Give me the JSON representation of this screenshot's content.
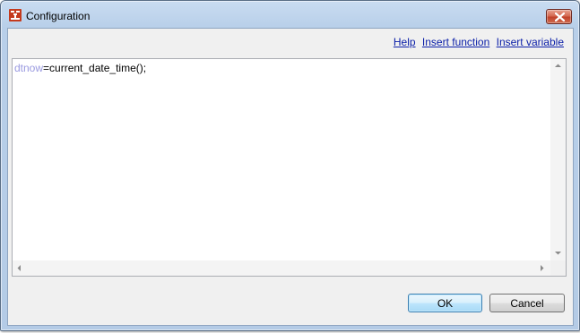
{
  "window": {
    "title": "Configuration",
    "app_icon": "flow-block-icon",
    "close_icon": "close-icon",
    "accent_color": "#c1432b"
  },
  "links": {
    "help": "Help",
    "insert_function": "Insert function",
    "insert_variable": "Insert variable",
    "link_color": "#0a1ea8"
  },
  "editor": {
    "variable": "dtnow",
    "expression": "=current_date_time();",
    "variable_color": "#9a9ae0"
  },
  "buttons": {
    "ok": "OK",
    "cancel": "Cancel"
  }
}
